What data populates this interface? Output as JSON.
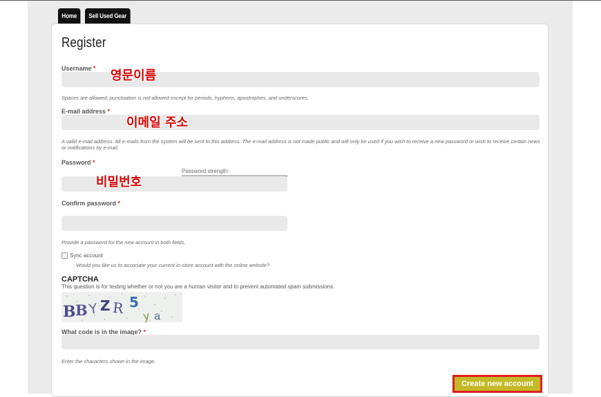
{
  "tabs": [
    "Home",
    "Sell Used Gear"
  ],
  "form": {
    "title": "Register",
    "required_mark": "*",
    "username": {
      "label": "Username",
      "value": "",
      "description": "Spaces are allowed; punctuation is not allowed except for periods, hyphens, apostrophes, and underscores."
    },
    "email": {
      "label": "E-mail address",
      "value": "",
      "description": "A valid e-mail address. All e-mails from the system will be sent to this address. The e-mail address is not made public and will only be used if you wish to receive a new password or wish to receive certain news or notifications by e-mail."
    },
    "password": {
      "label": "Password",
      "value": "",
      "strength_label": "Password strength:"
    },
    "confirm_password": {
      "label": "Confirm password",
      "value": "",
      "description": "Provide a password for the new account in both fields."
    },
    "sync": {
      "label": "Sync account",
      "checked": false,
      "description": "Would you like us to associate your current in-store account with the online website?"
    },
    "captcha": {
      "title": "CAPTCHA",
      "description": "This question is for testing whether or not you are a human visitor and to prevent automated spam submissions.",
      "image_text": "BBYZR5ya",
      "label": "What code is in the image?",
      "value": "",
      "hint": "Enter the characters shown in the image."
    },
    "submit_label": "Create new account"
  },
  "annotations": {
    "username": "영문이름",
    "email": "이메일 주소",
    "password": "비밀번호"
  },
  "colors": {
    "accent_button": "#c3b928",
    "highlight_border": "#e21d1d",
    "annotation_text": "#d80000",
    "required": "#e22233"
  }
}
